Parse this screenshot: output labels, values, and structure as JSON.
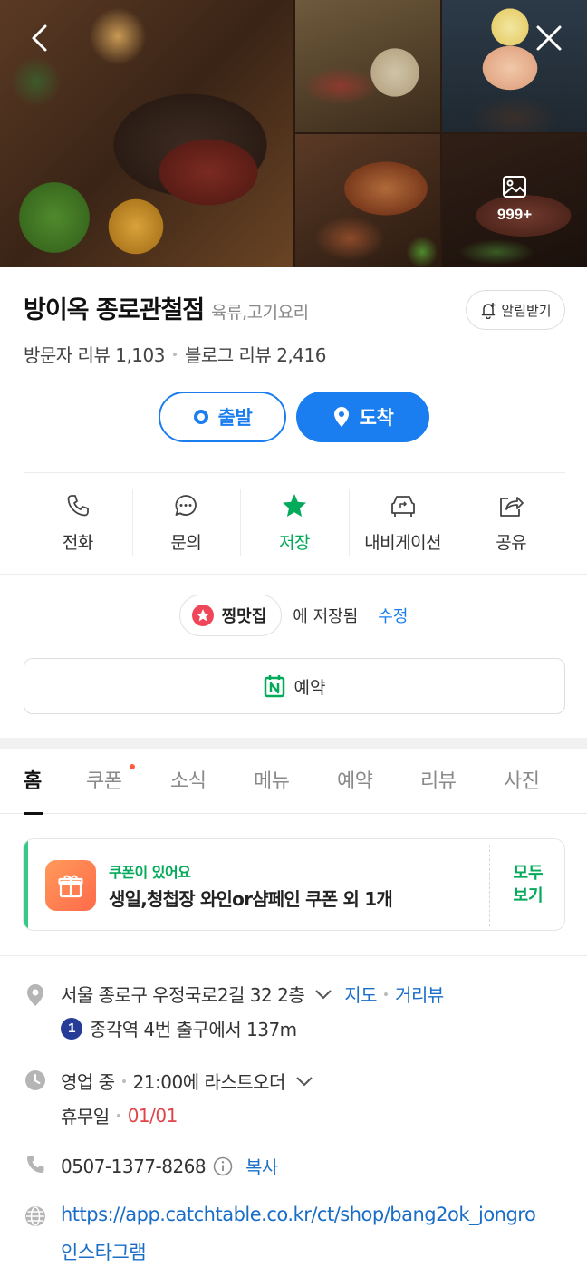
{
  "gallery": {
    "more_count": "999+",
    "back_icon": "chevron-left-icon",
    "close_icon": "close-icon"
  },
  "place": {
    "name": "방이옥 종로관철점",
    "category": "육류,고기요리",
    "alert_label": "알림받기",
    "visitor_reviews": "방문자 리뷰 1,103",
    "blog_reviews": "블로그 리뷰 2,416"
  },
  "directions": {
    "start_label": "출발",
    "arrive_label": "도착"
  },
  "actions": [
    {
      "label": "전화",
      "icon": "phone-icon"
    },
    {
      "label": "문의",
      "icon": "chat-icon"
    },
    {
      "label": "저장",
      "icon": "star-icon"
    },
    {
      "label": "내비게이션",
      "icon": "navigation-icon"
    },
    {
      "label": "공유",
      "icon": "share-icon"
    }
  ],
  "saved": {
    "list_name": "찡맛집",
    "saved_text": "에 저장됨",
    "edit_label": "수정"
  },
  "reserve_label": "예약",
  "tabs": [
    "홈",
    "쿠폰",
    "소식",
    "메뉴",
    "예약",
    "리뷰",
    "사진"
  ],
  "coupon": {
    "small": "쿠폰이 있어요",
    "main": "생일,청첩장 와인or샴페인 쿠폰 외 1개",
    "all_line1": "모두",
    "all_line2": "보기"
  },
  "info": {
    "address": "서울 종로구 우정국로2길 32 2층",
    "map_link": "지도",
    "street_link": "거리뷰",
    "subway_line": "1",
    "subway_text": "종각역 4번 출구에서 137m",
    "status": "영업 중",
    "last_order": "21:00에 라스트오더",
    "holiday_label": "휴무일",
    "holiday_date": "01/01",
    "phone": "0507-1377-8268",
    "copy_label": "복사",
    "url": "https://app.catchtable.co.kr/ct/shop/bang2ok_jongro",
    "instagram": "인스타그램"
  },
  "colors": {
    "primary_blue": "#1a7df0",
    "naver_green": "#03aa5a",
    "holiday_red": "#e0434a",
    "coupon_orange": "#ff7a4a"
  }
}
